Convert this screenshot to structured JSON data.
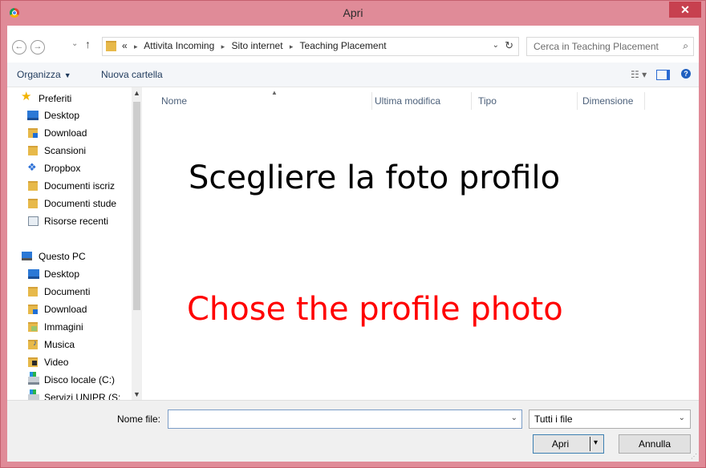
{
  "window": {
    "title": "Apri",
    "close_glyph": "✕",
    "accent_titlebar": "#e08b98",
    "close_color": "#c7404f"
  },
  "address": {
    "back_glyph": "←",
    "forward_glyph": "→",
    "recent_glyph": "⌄",
    "up_glyph": "↑",
    "overflow": "«",
    "segments": [
      "Attivita Incoming",
      "Sito internet",
      "Teaching Placement"
    ],
    "separator": "▸",
    "dropdown_glyph": "⌄",
    "refresh_glyph": "↻",
    "search_placeholder": "Cerca in Teaching Placement",
    "search_glyph": "⌕"
  },
  "toolbar": {
    "organize_label": "Organizza",
    "organize_caret": "▼",
    "new_folder_label": "Nuova cartella",
    "view_glyph": "☷ ▾",
    "help_glyph": "?"
  },
  "sidebar": {
    "favorites": [
      {
        "label": "Preferiti",
        "icon": "star-icon"
      },
      {
        "label": "Desktop",
        "icon": "desktop-icon"
      },
      {
        "label": "Download",
        "icon": "download-folder-icon"
      },
      {
        "label": "Scansioni",
        "icon": "folder-icon"
      },
      {
        "label": "Dropbox",
        "icon": "dropbox-icon"
      },
      {
        "label": "Documenti iscriz",
        "icon": "folder-icon"
      },
      {
        "label": "Documenti stude",
        "icon": "folder-icon"
      },
      {
        "label": "Risorse recenti",
        "icon": "recent-icon"
      }
    ],
    "pc": [
      {
        "label": "Questo PC",
        "icon": "computer-icon"
      },
      {
        "label": "Desktop",
        "icon": "desktop-icon"
      },
      {
        "label": "Documenti",
        "icon": "documents-folder-icon"
      },
      {
        "label": "Download",
        "icon": "download-folder-icon"
      },
      {
        "label": "Immagini",
        "icon": "pictures-folder-icon"
      },
      {
        "label": "Musica",
        "icon": "music-folder-icon"
      },
      {
        "label": "Video",
        "icon": "video-folder-icon"
      },
      {
        "label": "Disco locale (C:)",
        "icon": "drive-icon"
      },
      {
        "label": "Servizi UNIPR (S:",
        "icon": "network-drive-icon"
      }
    ],
    "scroll_up_glyph": "▲",
    "scroll_down_glyph": "▼",
    "star_glyph": "★",
    "dropbox_glyph": "❖"
  },
  "filelist": {
    "columns": [
      "Nome",
      "Ultima modifica",
      "Tipo",
      "Dimensione"
    ],
    "sort_glyph": "▲",
    "overlay_it": "Scegliere la foto profilo",
    "overlay_en": "Chose the profile photo",
    "overlay_en_color": "#ff0000"
  },
  "footer": {
    "filename_label": "Nome file:",
    "filename_value": "",
    "filename_dropdown_glyph": "⌄",
    "filter_value": "Tutti i file",
    "filter_dropdown_glyph": "⌄",
    "open_label": "Apri",
    "open_caret": "▾",
    "cancel_label": "Annulla",
    "grip_glyph": "⋰"
  }
}
